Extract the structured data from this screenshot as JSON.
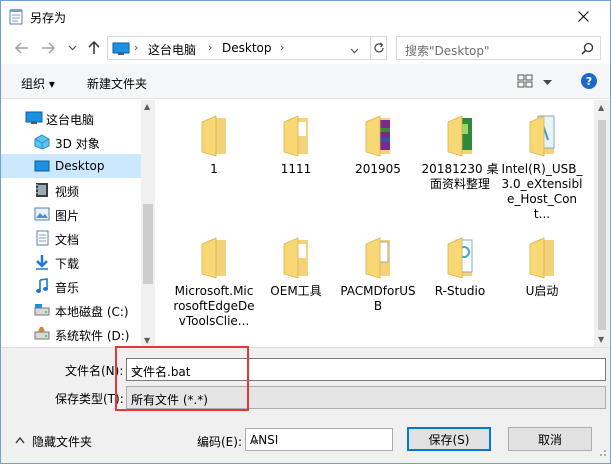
{
  "title": "另存为",
  "address": {
    "crumbs": [
      "这台电脑",
      "Desktop"
    ],
    "separator": "›"
  },
  "search": {
    "placeholder": "搜索\"Desktop\""
  },
  "toolbar": {
    "organize": "组织 ▾",
    "new_folder": "新建文件夹",
    "help": "?"
  },
  "nav": {
    "items": [
      {
        "label": "这台电脑",
        "icon": "computer-icon"
      },
      {
        "label": "3D 对象",
        "icon": "3d-objects-icon"
      },
      {
        "label": "Desktop",
        "icon": "desktop-icon"
      },
      {
        "label": "视频",
        "icon": "video-icon"
      },
      {
        "label": "图片",
        "icon": "pictures-icon"
      },
      {
        "label": "文档",
        "icon": "documents-icon"
      },
      {
        "label": "下载",
        "icon": "downloads-icon"
      },
      {
        "label": "音乐",
        "icon": "music-icon"
      },
      {
        "label": "本地磁盘 (C:)",
        "icon": "drive-icon"
      },
      {
        "label": "系统软件 (D:)",
        "icon": "drive-icon"
      }
    ]
  },
  "files": [
    {
      "label": "1",
      "icon": "folder-icon"
    },
    {
      "label": "1111",
      "icon": "folder-icon"
    },
    {
      "label": "201905",
      "icon": "folder-icon"
    },
    {
      "label": "20181230 桌面资料整理",
      "icon": "folder-icon"
    },
    {
      "label": "Intel(R)_USB_3.0_eXtensible_Host_Cont...",
      "icon": "folder-icon"
    },
    {
      "label": "Microsoft.MicrosoftEdgeDevToolsClie...",
      "icon": "folder-icon"
    },
    {
      "label": "OEM工具",
      "icon": "folder-icon"
    },
    {
      "label": "PACMDforUSB",
      "icon": "folder-icon"
    },
    {
      "label": "R-Studio",
      "icon": "folder-icon"
    },
    {
      "label": "U启动",
      "icon": "folder-icon"
    }
  ],
  "form": {
    "filename_label": "文件名(N):",
    "filename_value": "文件名.bat",
    "filetype_label": "保存类型(T):",
    "filetype_value": "所有文件 (*.*)",
    "hide_folders": "隐藏文件夹",
    "encoding_label": "编码(E):",
    "encoding_value": "ANSI",
    "save": "保存(S)",
    "cancel": "取消"
  },
  "colors": {
    "accent": "#0078d7",
    "selection": "#cce8ff",
    "highlight_box": "#e53935",
    "folder": "#f8d775"
  }
}
